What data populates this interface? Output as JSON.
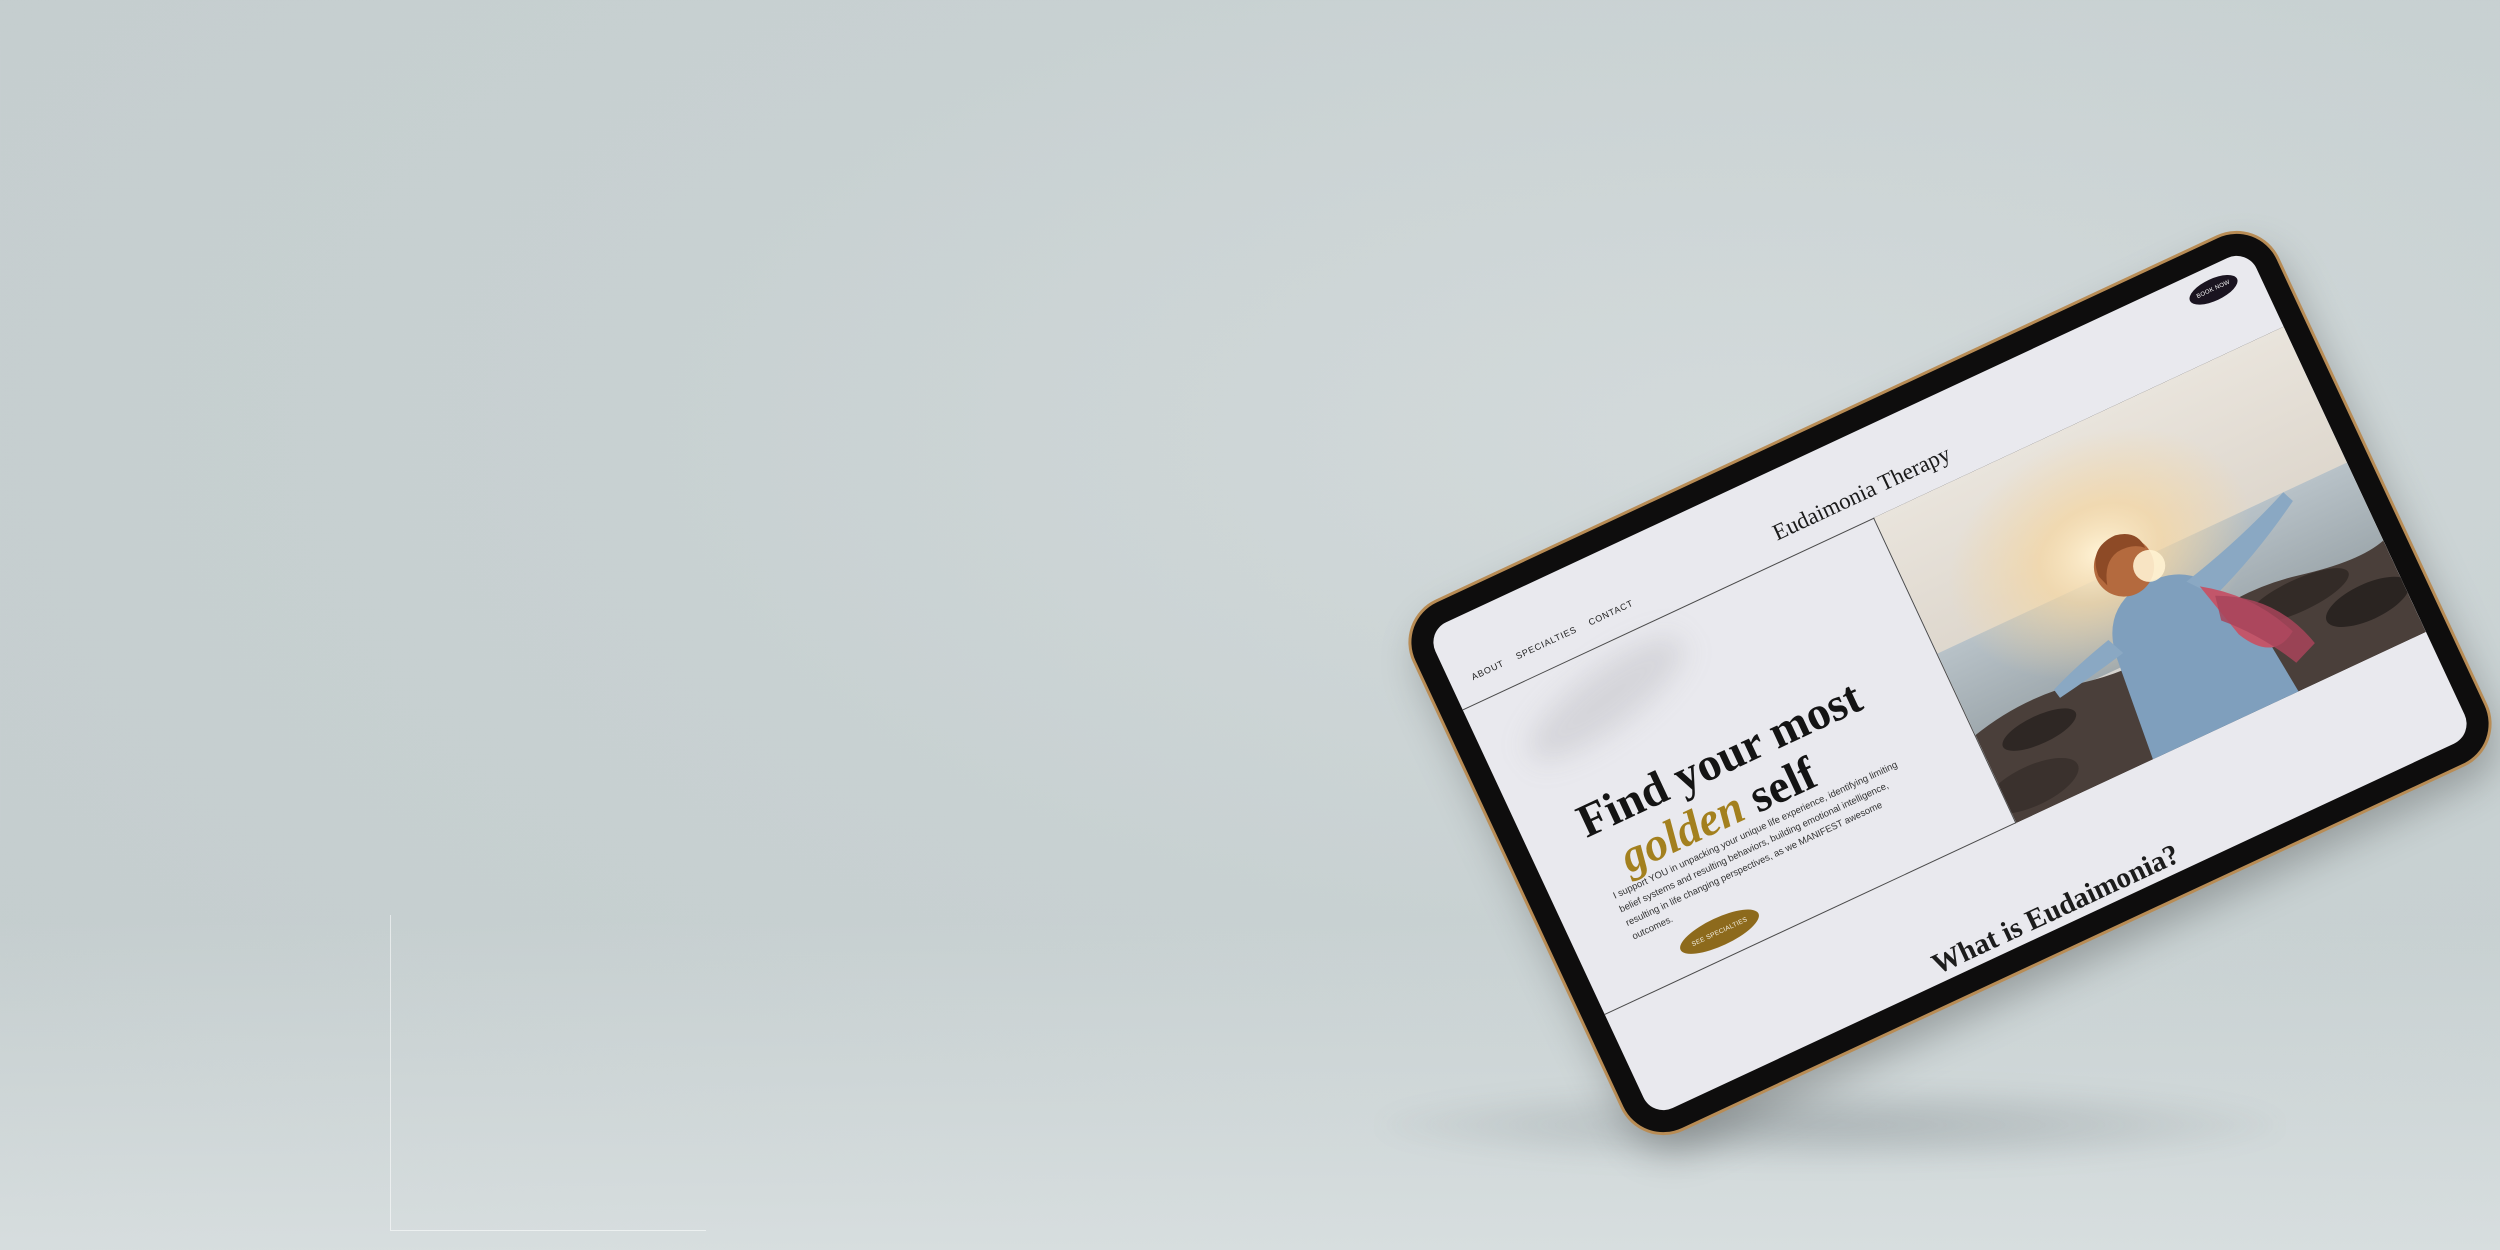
{
  "site": {
    "brand": "Eudaimonia Therapy",
    "nav": [
      {
        "label": "ABOUT"
      },
      {
        "label": "SPECIALTIES"
      },
      {
        "label": "CONTACT"
      }
    ],
    "book_button": "BOOK NOW"
  },
  "hero": {
    "headline_line1": "Find your most",
    "headline_accent": "golden",
    "headline_rest": " self",
    "body": "I support YOU in unpacking your unique life experience, identifying limiting belief systems and resulting behaviors, building emotional intelligence, resulting in life changing perspectives, as we MANIFEST awesome outcomes.",
    "cta": "SEE SPECIALTIES"
  },
  "section2": {
    "title": "What is Eudaimonia?"
  },
  "colors": {
    "background": "#c8d1d2",
    "screen": "#e9e9ee",
    "gold": "#a3801e",
    "button_gold": "#8d6a1c",
    "book_button": "#1a1420",
    "bezel": "#0e0d0d"
  }
}
